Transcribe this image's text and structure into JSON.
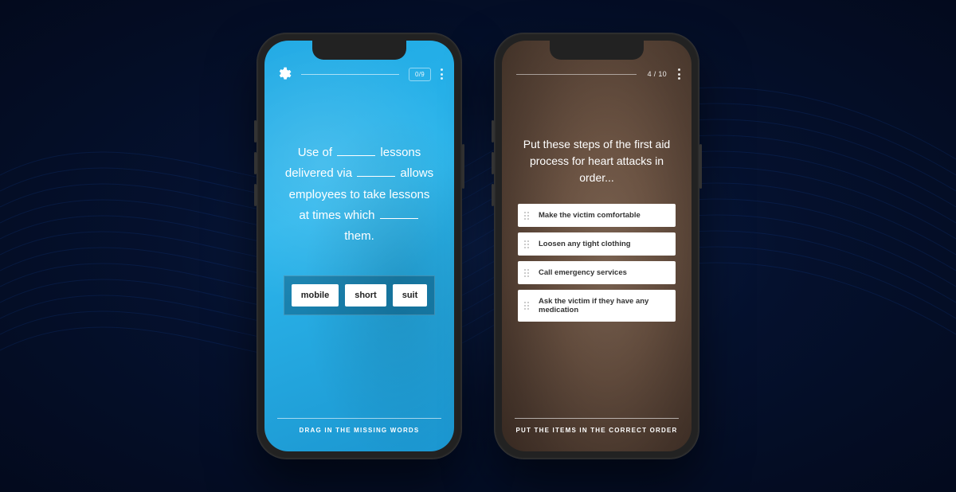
{
  "phoneA": {
    "progress_counter": "0/9",
    "cloze": {
      "seg1": "Use of ",
      "seg2": " lessons delivered via ",
      "seg3": " allows employees to take lessons at times which ",
      "seg4": " them."
    },
    "chips": [
      "mobile",
      "short",
      "suit"
    ],
    "footer_hint": "DRAG IN THE MISSING WORDS"
  },
  "phoneB": {
    "progress_counter": "4 / 10",
    "prompt": "Put these steps of the first aid process for heart attacks in order...",
    "items": [
      "Make the victim comfortable",
      "Loosen any tight clothing",
      "Call emergency services",
      "Ask the victim if they have any medication"
    ],
    "footer_hint": "PUT THE ITEMS IN THE CORRECT ORDER"
  }
}
